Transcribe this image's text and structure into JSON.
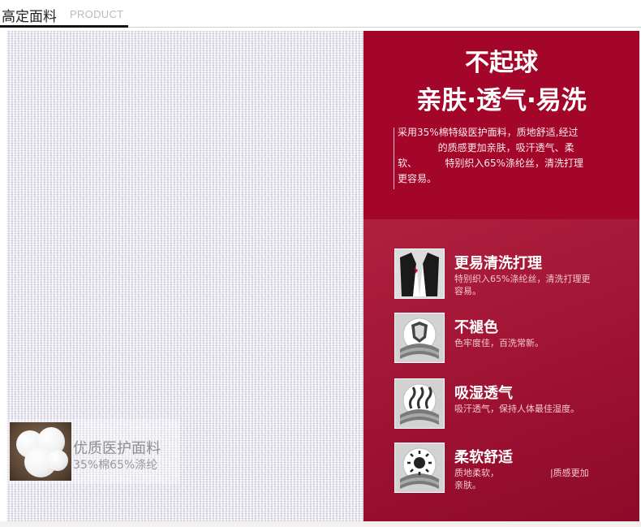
{
  "header": {
    "title": "高定面料",
    "subtitle": "PRODUCT"
  },
  "fabric": {
    "badge_title": "优质医护面料",
    "badge_spec": "35%棉65%涤纶"
  },
  "intro": {
    "headline1": "不起球",
    "headline2": "亲肤·透气·易洗",
    "description": "采用35%棉特级医护面料，质地舒适,经过\n             的质感更加亲肤，吸汗透气、柔\n软、         特别织入65%涤纶丝，清洗打理\n更容易。"
  },
  "features": [
    {
      "title": "更易清洗打理",
      "desc": "特别织入65%涤纶丝，清洗打理更\n容易。",
      "icon": "garment-icon"
    },
    {
      "title": "不褪色",
      "desc": "色牢度佳，百洗常新。",
      "icon": "shield-fabric-icon"
    },
    {
      "title": "吸湿透气",
      "desc": "吸汗透气，保持人体最佳湿度。",
      "icon": "breathable-fabric-icon"
    },
    {
      "title": "柔软舒适",
      "desc": "质地柔软，                  |质感更加\n亲肤。",
      "icon": "sun-fabric-icon"
    }
  ],
  "colors": {
    "accent": "#a4062a",
    "panel_dark": "#8d0a29",
    "fabric": "#e4e1ec"
  }
}
